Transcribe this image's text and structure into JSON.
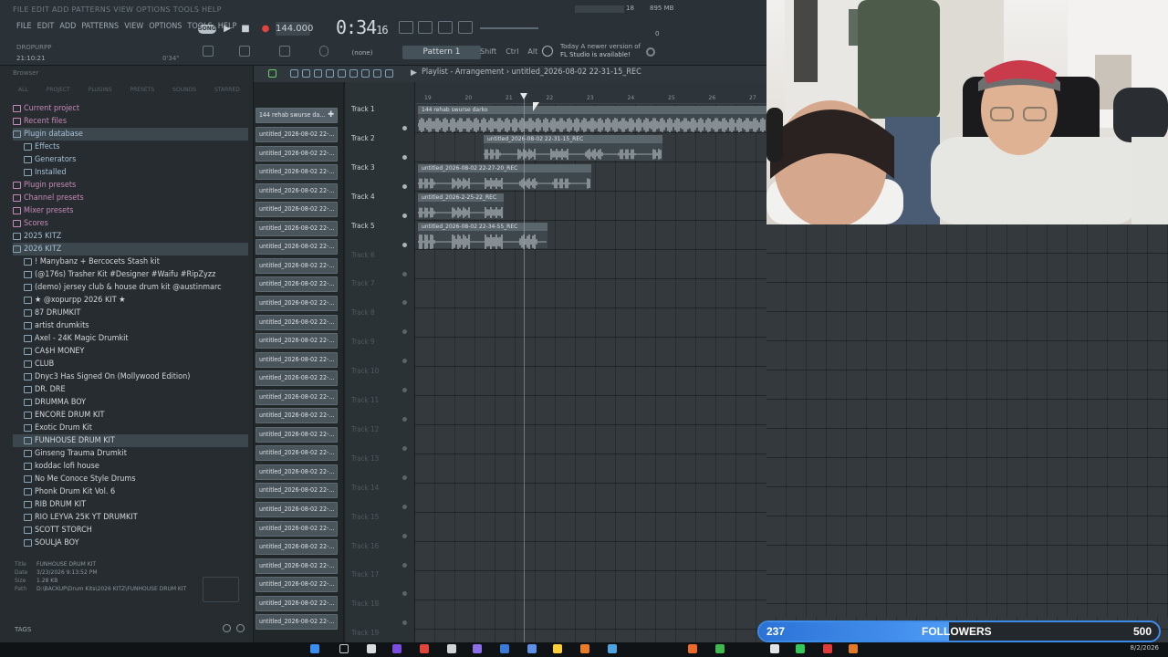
{
  "menu": [
    "FILE",
    "EDIT",
    "ADD",
    "PATTERNS",
    "VIEW",
    "OPTIONS",
    "TOOLS",
    "HELP"
  ],
  "ghost_menu": "FILE EDIT ADD PATTERNS VIEW OPTIONS TOOLS HELP",
  "song_mode": "SONG",
  "tempo": "144.000",
  "time": {
    "main": "0:34",
    "frac": "16"
  },
  "cpu": "18",
  "memory": "895 MB",
  "memory_sub": "0",
  "user_tag": "DROPURPP",
  "clock_small": "21:10:21",
  "bars_small": "0'34\"",
  "snap": "(none)",
  "pattern": "Pattern 1",
  "keys": [
    "Shift",
    "Ctrl",
    "Alt"
  ],
  "news": {
    "line1": "Today  A newer version of",
    "line2": "FL Studio is available!"
  },
  "browser": {
    "header": "Browser",
    "tabs": [
      "ALL",
      "PROJECT",
      "PLUGINS",
      "PRESETS",
      "SOUNDS",
      "STARRED"
    ],
    "tree": [
      {
        "label": "Current project",
        "cls": "root pink"
      },
      {
        "label": "Recent files",
        "cls": "root pink"
      },
      {
        "label": "Plugin database",
        "cls": "root plug sel"
      },
      {
        "label": "Effects",
        "cls": "sub plug"
      },
      {
        "label": "Generators",
        "cls": "sub plug"
      },
      {
        "label": "Installed",
        "cls": "sub plug"
      },
      {
        "label": "Plugin presets",
        "cls": "root pink"
      },
      {
        "label": "Channel presets",
        "cls": "root pink"
      },
      {
        "label": "Mixer presets",
        "cls": "root pink"
      },
      {
        "label": "Scores",
        "cls": "root pink"
      },
      {
        "label": "2025 KITZ",
        "cls": "root plug"
      },
      {
        "label": "2026 KITZ",
        "cls": "root plug sel"
      },
      {
        "label": "! Manybanz + Bercocets Stash kit",
        "cls": "sub"
      },
      {
        "label": "(@176s) Trasher Kit #Designer #Waifu #RipZyzz",
        "cls": "sub"
      },
      {
        "label": "(demo) jersey club & house drum kit @austinmarc",
        "cls": "sub"
      },
      {
        "label": "★ @xopurpp 2026 KIT ★",
        "cls": "sub"
      },
      {
        "label": "87 DRUMKIT",
        "cls": "sub"
      },
      {
        "label": "artist drumkits",
        "cls": "sub"
      },
      {
        "label": "Axel - 24K Magic Drumkit",
        "cls": "sub"
      },
      {
        "label": "CA$H MONEY",
        "cls": "sub"
      },
      {
        "label": "CLUB",
        "cls": "sub"
      },
      {
        "label": "Dnyc3 Has Signed On (Mollywood Edition)",
        "cls": "sub"
      },
      {
        "label": "DR. DRE",
        "cls": "sub"
      },
      {
        "label": "DRUMMA BOY",
        "cls": "sub"
      },
      {
        "label": "ENCORE DRUM KIT",
        "cls": "sub"
      },
      {
        "label": "Exotic Drum Kit",
        "cls": "sub"
      },
      {
        "label": "FUNHOUSE DRUM KIT",
        "cls": "sub sel"
      },
      {
        "label": "Ginseng Trauma Drumkit",
        "cls": "sub"
      },
      {
        "label": "koddac lofi house",
        "cls": "sub"
      },
      {
        "label": "No Me Conoce Style Drums",
        "cls": "sub"
      },
      {
        "label": "Phonk Drum Kit Vol. 6",
        "cls": "sub"
      },
      {
        "label": "RIB DRUM KIT",
        "cls": "sub"
      },
      {
        "label": "RIO LEYVA 25K YT DRUMKIT",
        "cls": "sub"
      },
      {
        "label": "SCOTT STORCH",
        "cls": "sub"
      },
      {
        "label": "SOULJA BOY",
        "cls": "sub"
      }
    ],
    "details": {
      "title_label": "Title",
      "title": "FUNHOUSE DRUM KIT",
      "date_label": "Date",
      "date": "3/23/2026 9:13:52 PM",
      "size_label": "Size",
      "size": "1.28 KB",
      "path_label": "Path",
      "path": "D:\\BACKUP\\Drum Kits\\2026 KITZ\\FUNHOUSE DRUM KIT"
    },
    "tags": "TAGS"
  },
  "playlist": {
    "title": "Playlist - Arrangement",
    "project": "untitled_2026-08-02 22-31-15_REC",
    "clip_list": [
      "144 rehab swurse da...",
      "untitled_2026-08-02 22-...",
      "untitled_2026-08-02 22-...",
      "untitled_2026-08-02 22-...",
      "untitled_2026-08-02 22-...",
      "untitled_2026-08-02 22-...",
      "untitled_2026-08-02 22-...",
      "untitled_2026-08-02 22-...",
      "untitled_2026-08-02 22-...",
      "untitled_2026-08-02 22-...",
      "untitled_2026-08-02 22-...",
      "untitled_2026-08-02 22-...",
      "untitled_2026-08-02 22-...",
      "untitled_2026-08-02 22-...",
      "untitled_2026-08-02 22-...",
      "untitled_2026-08-02 22-...",
      "untitled_2026-08-02 22-...",
      "untitled_2026-08-02 22-...",
      "untitled_2026-08-02 22-...",
      "untitled_2026-08-02 22-...",
      "untitled_2026-08-02 22-...",
      "untitled_2026-08-02 22-...",
      "untitled_2026-08-02 22-...",
      "untitled_2026-08-02 22-...",
      "untitled_2026-08-02 22-...",
      "untitled_2026-08-02 22-...",
      "untitled_2026-08-02 22-...",
      "untitled_2026-08-02 22-..."
    ],
    "ruler": [
      "19",
      "20",
      "21",
      "22",
      "23",
      "24",
      "25",
      "26",
      "27"
    ],
    "tracks": [
      "Track 1",
      "Track 2",
      "Track 3",
      "Track 4",
      "Track 5",
      "Track 6",
      "Track 7",
      "Track 8",
      "Track 9",
      "Track 10",
      "Track 11",
      "Track 12",
      "Track 13",
      "Track 14",
      "Track 15",
      "Track 16",
      "Track 17",
      "Track 18",
      "Track 19"
    ],
    "clips": [
      {
        "label": "144 rehab swurse darko"
      },
      {
        "label": "untitled_2026-08-02 22-31-15_REC"
      },
      {
        "label": "untitled_2026-08-02 22-27-20_REC"
      },
      {
        "label": "untitled_2026-2-25-22_REC"
      },
      {
        "label": "untitled_2026-08-02 22-34-55_REC"
      }
    ]
  },
  "followers": {
    "current": "237",
    "label": "FOLLOWERS",
    "goal": "500",
    "progress": 0.474
  },
  "date": "8/2/2026"
}
